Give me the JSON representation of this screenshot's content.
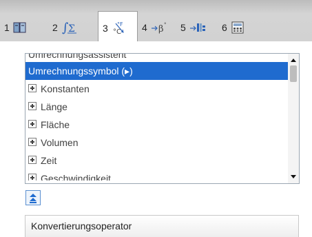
{
  "tabs": [
    {
      "number": "1",
      "icon": "catalog-book-icon",
      "active": false
    },
    {
      "number": "2",
      "icon": "math-templates-icon",
      "active": false
    },
    {
      "number": "3",
      "icon": "unit-conversion-icon",
      "active": true
    },
    {
      "number": "4",
      "icon": "symbols-icon",
      "active": false
    },
    {
      "number": "5",
      "icon": "library-icon",
      "active": false
    },
    {
      "number": "6",
      "icon": "calculator-icon",
      "active": false
    }
  ],
  "list": {
    "items": [
      {
        "label": "Umrechnungsassistent",
        "expandable": false
      },
      {
        "label": "Umrechnungssymbol (▸)",
        "expandable": false,
        "selected": true
      },
      {
        "label": "Konstanten",
        "expandable": true
      },
      {
        "label": "Länge",
        "expandable": true
      },
      {
        "label": "Fläche",
        "expandable": true
      },
      {
        "label": "Volumen",
        "expandable": true
      },
      {
        "label": "Zeit",
        "expandable": true
      },
      {
        "label": "Geschwindigkeit",
        "expandable": true
      }
    ]
  },
  "description": {
    "text": "Konvertierungsoperator"
  },
  "colors": {
    "selection": "#1f6bcf",
    "tabbar": "#d2d2d2"
  }
}
